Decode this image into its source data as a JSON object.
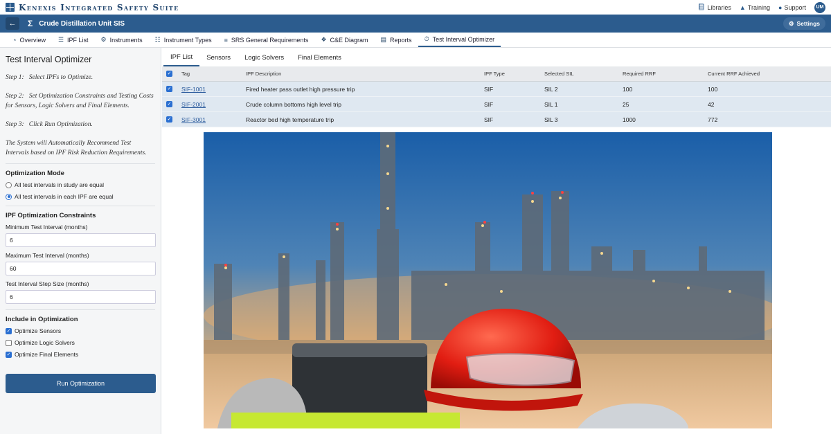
{
  "brand": {
    "name": "Kenexis Integrated Safety Suite"
  },
  "toplinks": [
    {
      "label": "Libraries",
      "icon": "book-icon"
    },
    {
      "label": "Training",
      "icon": "graduation-cap-icon"
    },
    {
      "label": "Support",
      "icon": "people-icon"
    }
  ],
  "user": {
    "initials": "UM"
  },
  "header": {
    "title": "Crude Distillation Unit SIS",
    "settings_label": "Settings"
  },
  "nav": [
    {
      "label": "Overview",
      "icon": "gauge-icon",
      "active": false
    },
    {
      "label": "IPF List",
      "icon": "list-icon",
      "active": false
    },
    {
      "label": "Instruments",
      "icon": "gear-icon",
      "active": false
    },
    {
      "label": "Instrument Types",
      "icon": "sitemap-icon",
      "active": false
    },
    {
      "label": "SRS General Requirements",
      "icon": "database-icon",
      "active": false
    },
    {
      "label": "C&E Diagram",
      "icon": "diagram-icon",
      "active": false
    },
    {
      "label": "Reports",
      "icon": "file-icon",
      "active": false
    },
    {
      "label": "Test Interval Optimizer",
      "icon": "stopwatch-icon",
      "active": true
    }
  ],
  "left": {
    "title": "Test Interval Optimizer",
    "steps": [
      "Step 1:   Select IPFs to Optimize.",
      "Step 2:   Set Optimization Constraints and Testing Costs for Sensors, Logic Solvers and Final Elements.",
      "Step 3:   Click Run Optimization.",
      "The System will Automatically Recommend Test Intervals based on IPF Risk Reduction Requirements."
    ],
    "mode_title": "Optimization Mode",
    "modes": [
      {
        "label": "All test intervals in study are equal",
        "selected": false
      },
      {
        "label": "All test intervals in each IPF are equal",
        "selected": true
      }
    ],
    "constraints_title": "IPF Optimization Constraints",
    "min_label": "Minimum Test Interval (months)",
    "min_value": "6",
    "max_label": "Maximum Test Interval (months)",
    "max_value": "60",
    "step_label": "Test Interval Step Size (months)",
    "step_value": "6",
    "include_title": "Include in Optimization",
    "includes": [
      {
        "label": "Optimize Sensors",
        "checked": true
      },
      {
        "label": "Optimize Logic Solvers",
        "checked": false
      },
      {
        "label": "Optimize Final Elements",
        "checked": true
      }
    ],
    "run_label": "Run Optimization"
  },
  "subtabs": [
    {
      "label": "IPF List",
      "active": true
    },
    {
      "label": "Sensors",
      "active": false
    },
    {
      "label": "Logic Solvers",
      "active": false
    },
    {
      "label": "Final Elements",
      "active": false
    }
  ],
  "table": {
    "headers": [
      "Tag",
      "IPF Description",
      "IPF Type",
      "Selected SIL",
      "Required RRF",
      "Current RRF Achieved"
    ],
    "rows": [
      {
        "tag": "SIF-1001",
        "desc": "Fired heater pass outlet high pressure trip",
        "type": "SIF",
        "sil": "SIL 2",
        "rrf": "100",
        "achieved": "100"
      },
      {
        "tag": "SIF-2001",
        "desc": "Crude column bottoms high level trip",
        "type": "SIF",
        "sil": "SIL 1",
        "rrf": "25",
        "achieved": "42"
      },
      {
        "tag": "SIF-3001",
        "desc": "Reactor bed high temperature trip",
        "type": "SIF",
        "sil": "SIL 3",
        "rrf": "1000",
        "achieved": "772"
      }
    ]
  },
  "colors": {
    "primary": "#2c5c8e",
    "accent": "#2a6fd1",
    "row_bg": "#dfe8f1"
  }
}
